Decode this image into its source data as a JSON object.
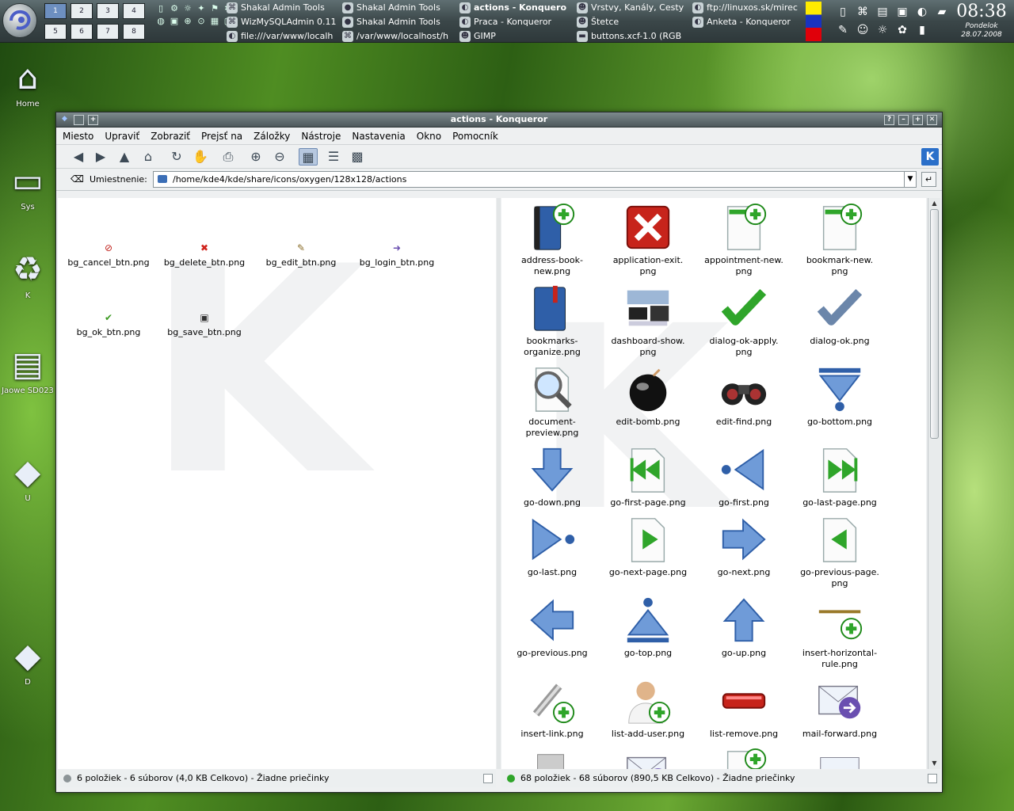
{
  "panel": {
    "pagers": [
      "1",
      "2",
      "3",
      "4",
      "5",
      "6",
      "7",
      "8"
    ],
    "tasks": [
      {
        "label": "Shakal Admin Tools",
        "icon": "⌘",
        "bold": false
      },
      {
        "label": "WizMySQLAdmin 0.11",
        "icon": "⌘",
        "bold": false
      },
      {
        "label": "file:///var/www/localh",
        "icon": "◐",
        "bold": false
      },
      {
        "label": "Shakal Admin Tools",
        "icon": "●",
        "bold": false
      },
      {
        "label": "Shakal Admin Tools",
        "icon": "●",
        "bold": false
      },
      {
        "label": "/var/www/localhost/h",
        "icon": "⌘",
        "bold": false
      },
      {
        "label": "actions - Konquero",
        "icon": "◐",
        "bold": true
      },
      {
        "label": "Praca - Konqueror",
        "icon": "◐",
        "bold": false
      },
      {
        "label": "GIMP",
        "icon": "☻",
        "bold": false
      },
      {
        "label": "Vrstvy, Kanály, Cesty",
        "icon": "☻",
        "bold": false
      },
      {
        "label": "Štetce",
        "icon": "☻",
        "bold": false
      },
      {
        "label": "buttons.xcf-1.0 (RGB",
        "icon": "▬",
        "bold": false
      },
      {
        "label": "ftp://linuxos.sk/mirec",
        "icon": "◐",
        "bold": false
      },
      {
        "label": "Anketa - Konqueror",
        "icon": "◐",
        "bold": false
      }
    ],
    "clock": {
      "time": "08:38",
      "day": "Pondelok",
      "date": "28.07.2008"
    }
  },
  "desktop": {
    "icons": [
      {
        "label": "Home",
        "glyph": "⌂"
      },
      {
        "label": "Sys",
        "glyph": "▭"
      },
      {
        "label": "K",
        "glyph": "♻"
      },
      {
        "label": "Jaowe SD023",
        "glyph": "▤"
      },
      {
        "label": "U",
        "glyph": "◆"
      },
      {
        "label": "D",
        "glyph": "◆"
      }
    ]
  },
  "window": {
    "title": "actions - Konqueror",
    "menu": [
      "Miesto",
      "Upraviť",
      "Zobraziť",
      "Prejsť na",
      "Záložky",
      "Nástroje",
      "Nastavenia",
      "Okno",
      "Pomocník"
    ],
    "location_label": "Umiestnenie:",
    "location_value": "/home/kde4/kde/share/icons/oxygen/128x128/actions"
  },
  "left_pane": {
    "files": [
      {
        "name": "bg_cancel_btn.png",
        "glyph": "⊘",
        "color": "#c0201a"
      },
      {
        "name": "bg_delete_btn.png",
        "glyph": "✖",
        "color": "#d0231c"
      },
      {
        "name": "bg_edit_btn.png",
        "glyph": "✎",
        "color": "#8a6d2a"
      },
      {
        "name": "bg_login_btn.png",
        "glyph": "➜",
        "color": "#6a4fb0"
      },
      {
        "name": "bg_ok_btn.png",
        "glyph": "✔",
        "color": "#3c9a22"
      },
      {
        "name": "bg_save_btn.png",
        "glyph": "▣",
        "color": "#333333"
      }
    ],
    "status": "6 položiek - 6 súborov (4,0 KB Celkovo) - Žiadne priečinky"
  },
  "right_pane": {
    "files": [
      {
        "name": "address-book-new.png",
        "lines": [
          "address-book-",
          "new.png"
        ],
        "icon": "book-add"
      },
      {
        "name": "application-exit.png",
        "lines": [
          "application-exit.",
          "png"
        ],
        "icon": "exit"
      },
      {
        "name": "appointment-new.png",
        "lines": [
          "appointment-new.",
          "png"
        ],
        "icon": "page-add"
      },
      {
        "name": "bookmark-new.png",
        "lines": [
          "bookmark-new.",
          "png"
        ],
        "icon": "page-add"
      },
      {
        "name": "bookmarks-organize.png",
        "lines": [
          "bookmarks-",
          "organize.png"
        ],
        "icon": "book"
      },
      {
        "name": "dashboard-show.png",
        "lines": [
          "dashboard-show.",
          "png"
        ],
        "icon": "dashboard"
      },
      {
        "name": "dialog-ok-apply.png",
        "lines": [
          "dialog-ok-apply.",
          "png"
        ],
        "icon": "check-green"
      },
      {
        "name": "dialog-ok.png",
        "lines": [
          "dialog-ok.png"
        ],
        "icon": "check-blue"
      },
      {
        "name": "document-preview.png",
        "lines": [
          "document-",
          "preview.png"
        ],
        "icon": "magnifier"
      },
      {
        "name": "edit-bomb.png",
        "lines": [
          "edit-bomb.png"
        ],
        "icon": "bomb"
      },
      {
        "name": "edit-find.png",
        "lines": [
          "edit-find.png"
        ],
        "icon": "binoculars"
      },
      {
        "name": "go-bottom.png",
        "lines": [
          "go-bottom.png"
        ],
        "icon": "arrow-bottom"
      },
      {
        "name": "go-down.png",
        "lines": [
          "go-down.png"
        ],
        "icon": "arrow-down"
      },
      {
        "name": "go-first-page.png",
        "lines": [
          "go-first-page.png"
        ],
        "icon": "page-first"
      },
      {
        "name": "go-first.png",
        "lines": [
          "go-first.png"
        ],
        "icon": "arrow-first"
      },
      {
        "name": "go-last-page.png",
        "lines": [
          "go-last-page.png"
        ],
        "icon": "page-last"
      },
      {
        "name": "go-last.png",
        "lines": [
          "go-last.png"
        ],
        "icon": "arrow-last"
      },
      {
        "name": "go-next-page.png",
        "lines": [
          "go-next-page.png"
        ],
        "icon": "page-next"
      },
      {
        "name": "go-next.png",
        "lines": [
          "go-next.png"
        ],
        "icon": "arrow-right"
      },
      {
        "name": "go-previous-page.png",
        "lines": [
          "go-previous-page.",
          "png"
        ],
        "icon": "page-prev"
      },
      {
        "name": "go-previous.png",
        "lines": [
          "go-previous.png"
        ],
        "icon": "arrow-left"
      },
      {
        "name": "go-top.png",
        "lines": [
          "go-top.png"
        ],
        "icon": "arrow-top"
      },
      {
        "name": "go-up.png",
        "lines": [
          "go-up.png"
        ],
        "icon": "arrow-up"
      },
      {
        "name": "insert-horizontal-rule.png",
        "lines": [
          "insert-horizontal-",
          "rule.png"
        ],
        "icon": "hrule"
      },
      {
        "name": "insert-link.png",
        "lines": [
          "insert-link.png"
        ],
        "icon": "link"
      },
      {
        "name": "list-add-user.png",
        "lines": [
          "list-add-user.png"
        ],
        "icon": "user-add"
      },
      {
        "name": "list-remove.png",
        "lines": [
          "list-remove.png"
        ],
        "icon": "remove"
      },
      {
        "name": "mail-forward.png",
        "lines": [
          "mail-forward.png"
        ],
        "icon": "mail-forward"
      }
    ],
    "status": "68 položiek - 68 súborov (890,5 KB Celkovo) - Žiadne priečinky"
  },
  "colors": {
    "accent": "#3b6eb6",
    "green": "#2fa52a",
    "red": "#c7241b"
  }
}
